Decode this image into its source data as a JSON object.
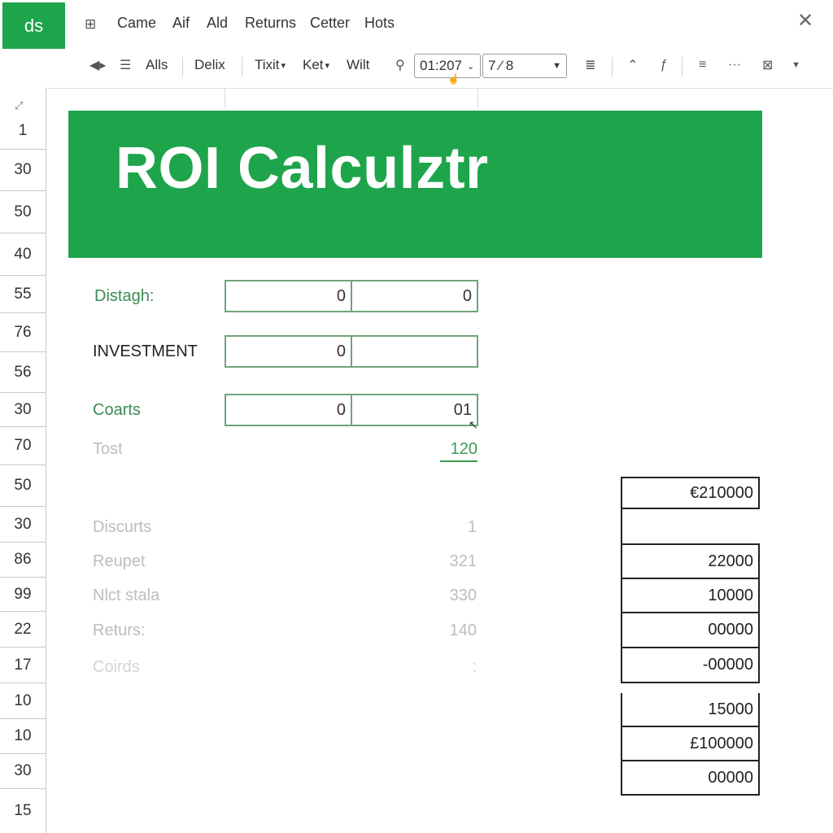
{
  "app": {
    "logo": "ds"
  },
  "menu": [
    "Came",
    "Aif",
    "Ald",
    "Returns",
    "Cetter",
    "Hots"
  ],
  "toolbar": {
    "alls": "Alls",
    "delix": "Delix",
    "tixit": "Tixit",
    "ket": "Ket",
    "wilt": "Wilt",
    "time_value": "01:207",
    "size_value": "7 ⁄ 8"
  },
  "row_headers": [
    "1",
    "30",
    "50",
    "40",
    "55",
    "76",
    "56",
    "30",
    "70",
    "50",
    "30",
    "86",
    "99",
    "22",
    "17",
    "10",
    "10",
    "30",
    "15"
  ],
  "sheet": {
    "title": "ROI Calculztr",
    "inputs": [
      {
        "label": "Distagh:",
        "left": "0",
        "right": "0"
      },
      {
        "label": "INVESTMENT",
        "left": "0",
        "right": ""
      },
      {
        "label": "Coarts",
        "left": "0",
        "right": "01"
      }
    ],
    "total": {
      "label": "Tost",
      "value": "120"
    },
    "summary": [
      {
        "label": "Discurts",
        "value": "1"
      },
      {
        "label": "Reupet",
        "value": "321"
      },
      {
        "label": "Nlct stala",
        "value": "330"
      },
      {
        "label": "Returs:",
        "value": "140"
      },
      {
        "label": "Coirds",
        "value": ":"
      }
    ],
    "right_values": [
      "€210000",
      "",
      "22000",
      "10000",
      "00000",
      "-00000",
      "15000",
      "£100000",
      "00000"
    ]
  },
  "colors": {
    "accent": "#1ea44b",
    "input_border": "#6fa47a"
  }
}
